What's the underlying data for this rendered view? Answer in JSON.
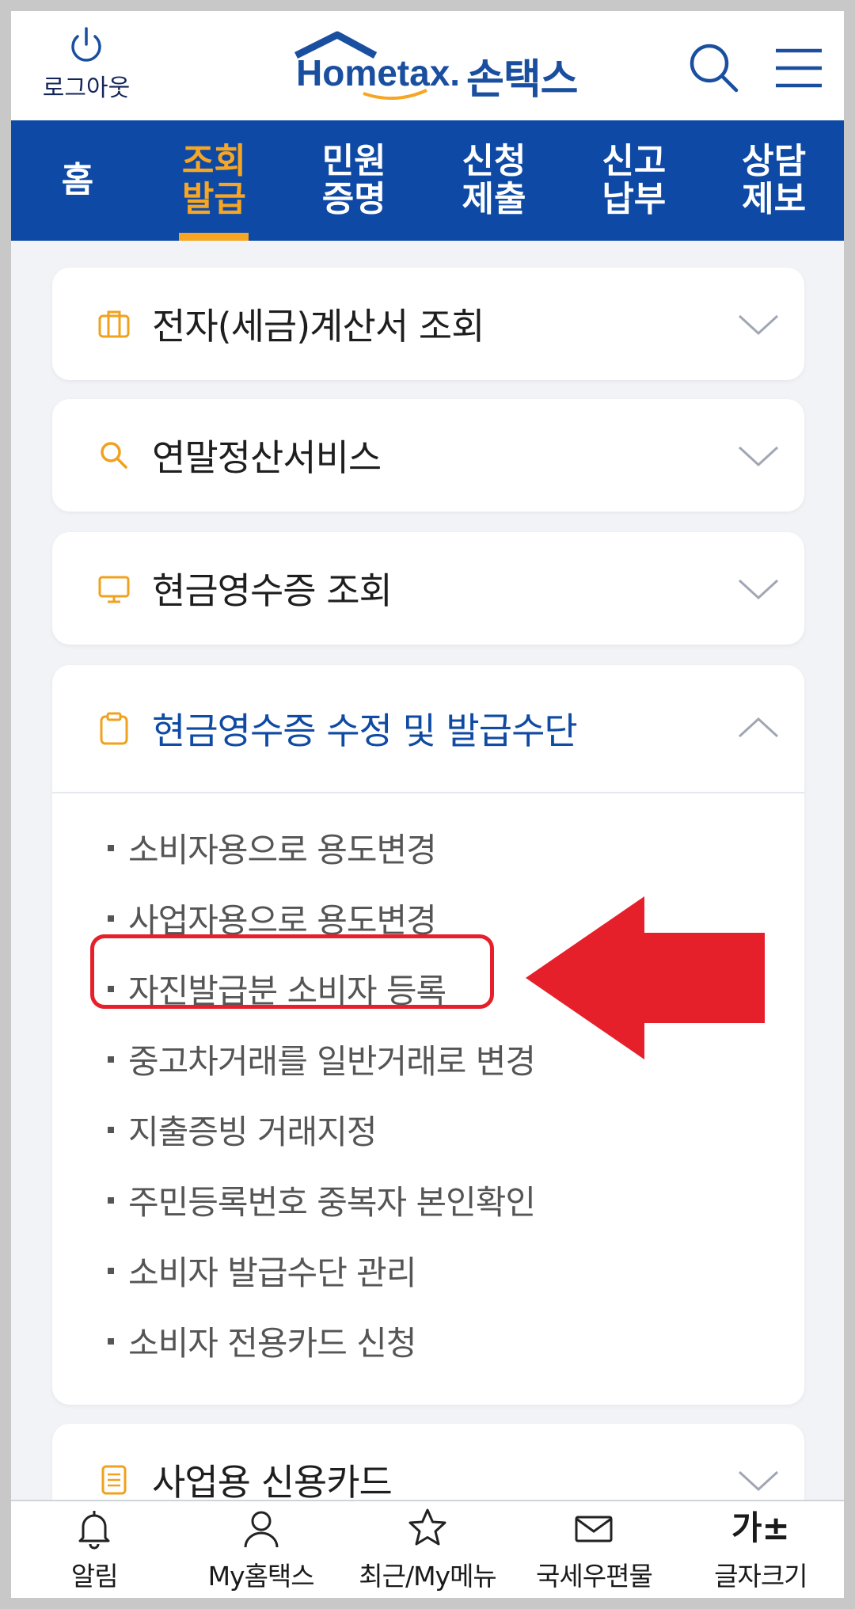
{
  "header": {
    "logout_label": "로그아웃",
    "logo_word": "Hometax.",
    "brand_name": "손택스",
    "search_icon": "search-icon",
    "menu_icon": "hamburger-menu-icon"
  },
  "nav": {
    "items": [
      {
        "label": "홈",
        "active": false
      },
      {
        "label": "조회\n발급",
        "active": true
      },
      {
        "label": "민원\n증명",
        "active": false
      },
      {
        "label": "신청\n제출",
        "active": false
      },
      {
        "label": "신고\n납부",
        "active": false
      },
      {
        "label": "상담\n제보",
        "active": false
      }
    ],
    "active_color": "#f6a623",
    "bg_color": "#0e4aa5"
  },
  "sections": [
    {
      "title": "전자(세금)계산서 조회",
      "icon": "briefcase-icon",
      "expanded": false
    },
    {
      "title": "연말정산서비스",
      "icon": "search-icon",
      "expanded": false
    },
    {
      "title": "현금영수증 조회",
      "icon": "monitor-icon",
      "expanded": false
    },
    {
      "title": "현금영수증 수정 및 발급수단",
      "icon": "clipboard-icon",
      "expanded": true,
      "items": [
        "소비자용으로 용도변경",
        "사업자용으로 용도변경",
        "자진발급분 소비자 등록",
        "중고차거래를 일반거래로 변경",
        "지출증빙 거래지정",
        "주민등록번호 중복자 본인확인",
        "소비자 발급수단 관리",
        "소비자 전용카드 신청"
      ],
      "highlighted_item": "자진발급분 소비자 등록"
    },
    {
      "title": "사업용 신용카드",
      "icon": "document-icon",
      "expanded": false
    }
  ],
  "annotation": {
    "highlight_color": "#e6202b",
    "arrow_color": "#e6202b"
  },
  "bottom_bar": [
    {
      "label": "알림",
      "icon": "bell-icon"
    },
    {
      "label": "My홈택스",
      "icon": "user-icon"
    },
    {
      "label": "최근/My메뉴",
      "icon": "star-icon"
    },
    {
      "label": "국세우편물",
      "icon": "mail-icon"
    },
    {
      "label": "글자크기",
      "icon_text": "가±"
    }
  ]
}
